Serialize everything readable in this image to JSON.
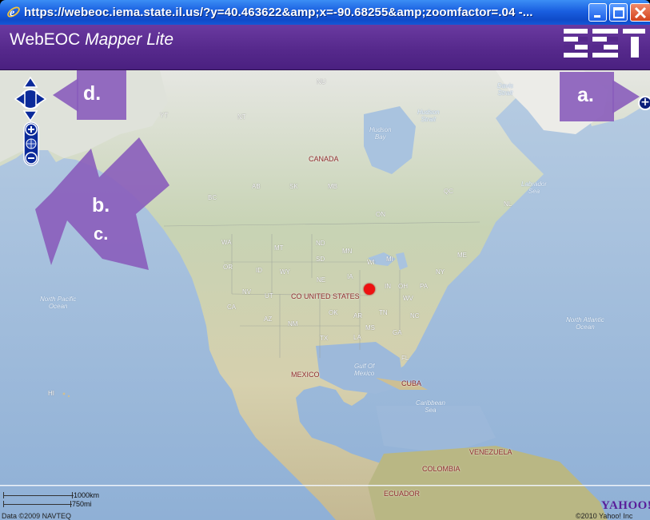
{
  "window": {
    "title": "https://webeoc.iema.state.il.us/?y=40.463622&amp;x=-90.68255&amp;zoomfactor=.04 -...",
    "icon": "ie-icon",
    "buttons": [
      "minimize",
      "maximize",
      "close"
    ]
  },
  "app": {
    "title_prefix": "WebEOC",
    "title_italic": "Mapper Lite",
    "logo": "ESI"
  },
  "map": {
    "labels": {
      "nu": "NU",
      "yt": "YT",
      "nt": "NT",
      "canada": "CANADA",
      "hudson_bay": "Hudson\nBay",
      "hudson_strait": "Hudson\nStrait",
      "davis_strait": "Davis\nStrait",
      "labrador_sea": "Labrador\nSea",
      "bc": "BC",
      "ab": "AB",
      "sk": "SK",
      "mb": "MB",
      "on": "ON",
      "qc": "QC",
      "nl": "NL",
      "wa": "WA",
      "mt": "MT",
      "nd": "ND",
      "mn": "MN",
      "or": "OR",
      "id": "ID",
      "wy": "WY",
      "sd": "SD",
      "wi": "WI",
      "mi": "MI",
      "ne": "NE",
      "ia": "IA",
      "me": "ME",
      "ny": "NY",
      "pa": "PA",
      "nv": "NV",
      "ut": "UT",
      "co": "CO",
      "united_states": "UNITED STATES",
      "in": "IN",
      "oh": "OH",
      "wv": "WV",
      "ca": "CA",
      "az": "AZ",
      "nm": "NM",
      "ok": "OK",
      "ar": "AR",
      "tn": "TN",
      "nc": "NC",
      "ms": "MS",
      "ga": "GA",
      "tx": "TX",
      "la": "LA",
      "fl": "FL",
      "north_pacific": "North Pacific\nOcean",
      "north_atlantic": "North Atlantic\nOcean",
      "gulf_of_mexico": "Gulf Of\nMexico",
      "mexico": "MEXICO",
      "cuba": "CUBA",
      "caribbean": "Caribbean\nSea",
      "hi": "HI",
      "venezuela": "VENEZUELA",
      "colombia": "COLOMBIA",
      "ecuador": "ECUADOR"
    },
    "marker_color": "#ee1111",
    "callouts": {
      "a": "a.",
      "b": "b.",
      "c": "c.",
      "d": "d."
    },
    "scale": {
      "km": "1000km",
      "mi": "750mi"
    },
    "copyright_left": "Data ©2009 NAVTEQ",
    "copyright_right": "©2010 Yahoo! Inc",
    "provider": "YAHOO!"
  },
  "colors": {
    "titlebar": "#1a5fe0",
    "header": "#56298c",
    "callout": "#8a5dbb",
    "nav": "#0b2a9a"
  }
}
